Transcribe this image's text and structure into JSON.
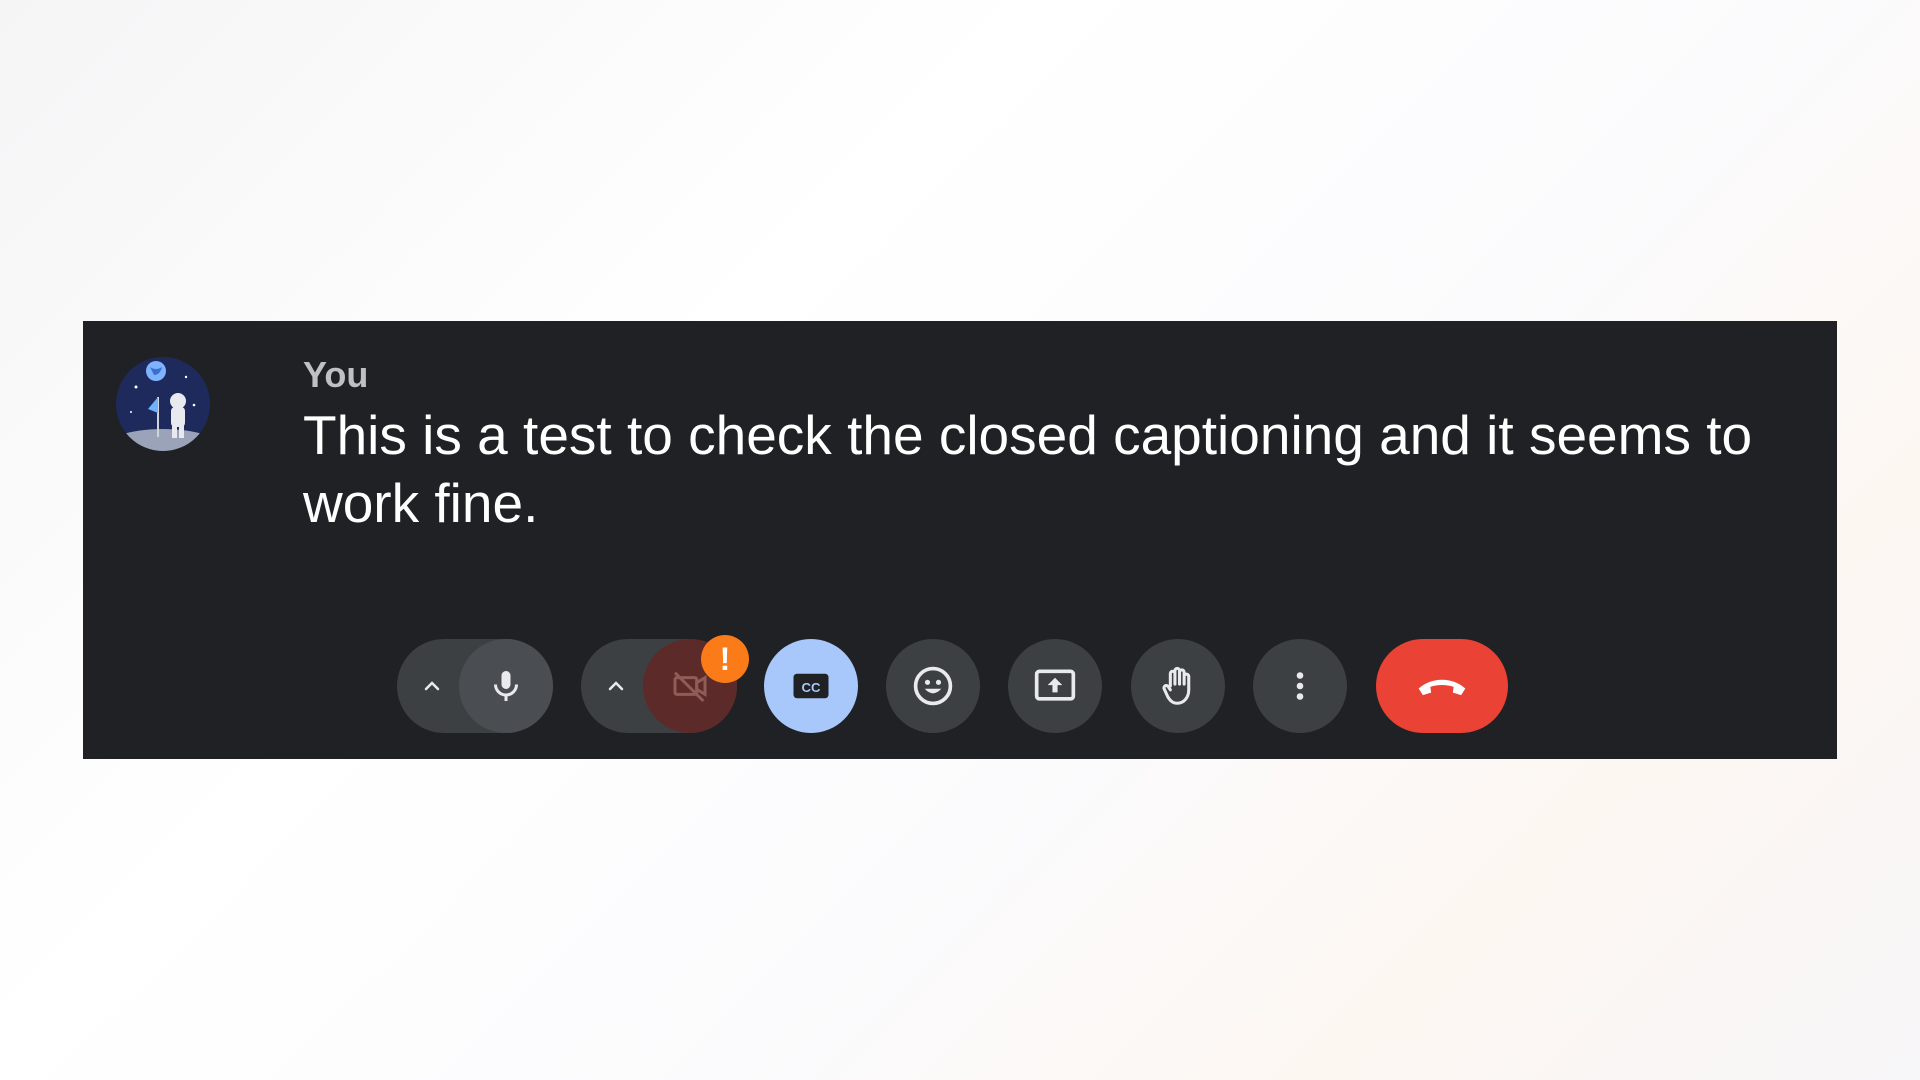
{
  "caption_panel": {
    "speaker": "You",
    "text": "This is a test to check the closed captioning and it seems to work fine.",
    "avatar": "astronaut-on-moon-avatar"
  },
  "controls": {
    "audio": {
      "options_icon": "chevron-up-icon",
      "icon": "microphone-icon",
      "state": "on"
    },
    "video": {
      "options_icon": "chevron-up-icon",
      "icon": "camera-off-icon",
      "state": "off",
      "warning_badge": "!"
    },
    "captions": {
      "icon": "cc-icon",
      "state": "active"
    },
    "reactions": {
      "icon": "emoji-icon"
    },
    "present": {
      "icon": "present-screen-icon"
    },
    "raise_hand": {
      "icon": "hand-icon"
    },
    "more_options": {
      "icon": "more-vert-icon"
    },
    "leave_call": {
      "icon": "call-end-icon"
    }
  },
  "colors": {
    "panel_bg": "#202124",
    "button_bg": "#3c4043",
    "captions_active": "#a8c7fa",
    "end_call": "#ea4335",
    "warning": "#fa7b17",
    "camera_off_bg": "#5c2b29"
  }
}
